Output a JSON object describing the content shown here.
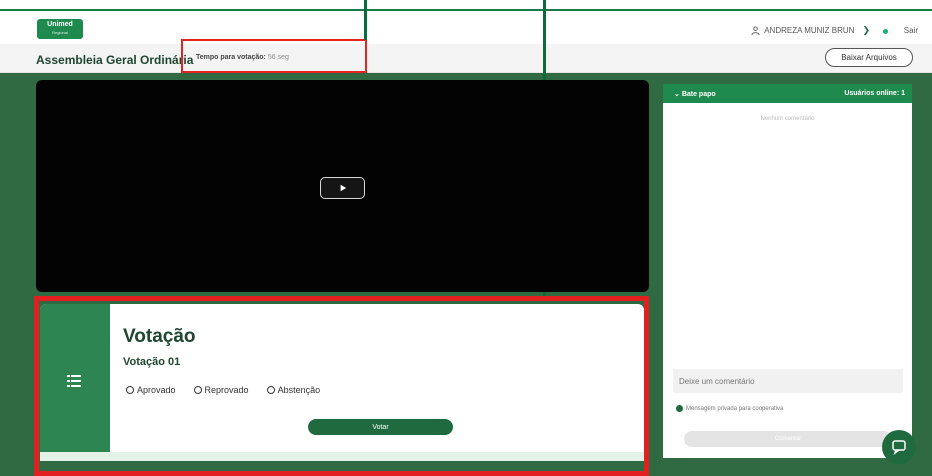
{
  "header": {
    "logo_text": "Unimed",
    "logo_sub": "Regional",
    "user_name": "ANDREZA MUNIZ BRUN",
    "logout": "Sair"
  },
  "titlebar": {
    "title": "Assembleia Geral Ordinária",
    "timer_label": "Tempo para votação:",
    "timer_value": "56 seg",
    "download_button": "Baixar Arquivos"
  },
  "vote": {
    "title": "Votação",
    "subtitle": "Votação 01",
    "options": [
      "Aprovado",
      "Reprovado",
      "Abstenção"
    ],
    "submit": "Votar"
  },
  "chat": {
    "title": "Bate papo",
    "online": "Usuários online: 1",
    "empty": "Nenhum comentário",
    "placeholder": "Deixe um comentário",
    "private_label": "Mensagem privada para cooperativa",
    "submit": "Comentar"
  },
  "colors": {
    "brand_green": "#1f8a4e",
    "dark_green": "#1e4630",
    "highlight_red": "#e42424"
  }
}
